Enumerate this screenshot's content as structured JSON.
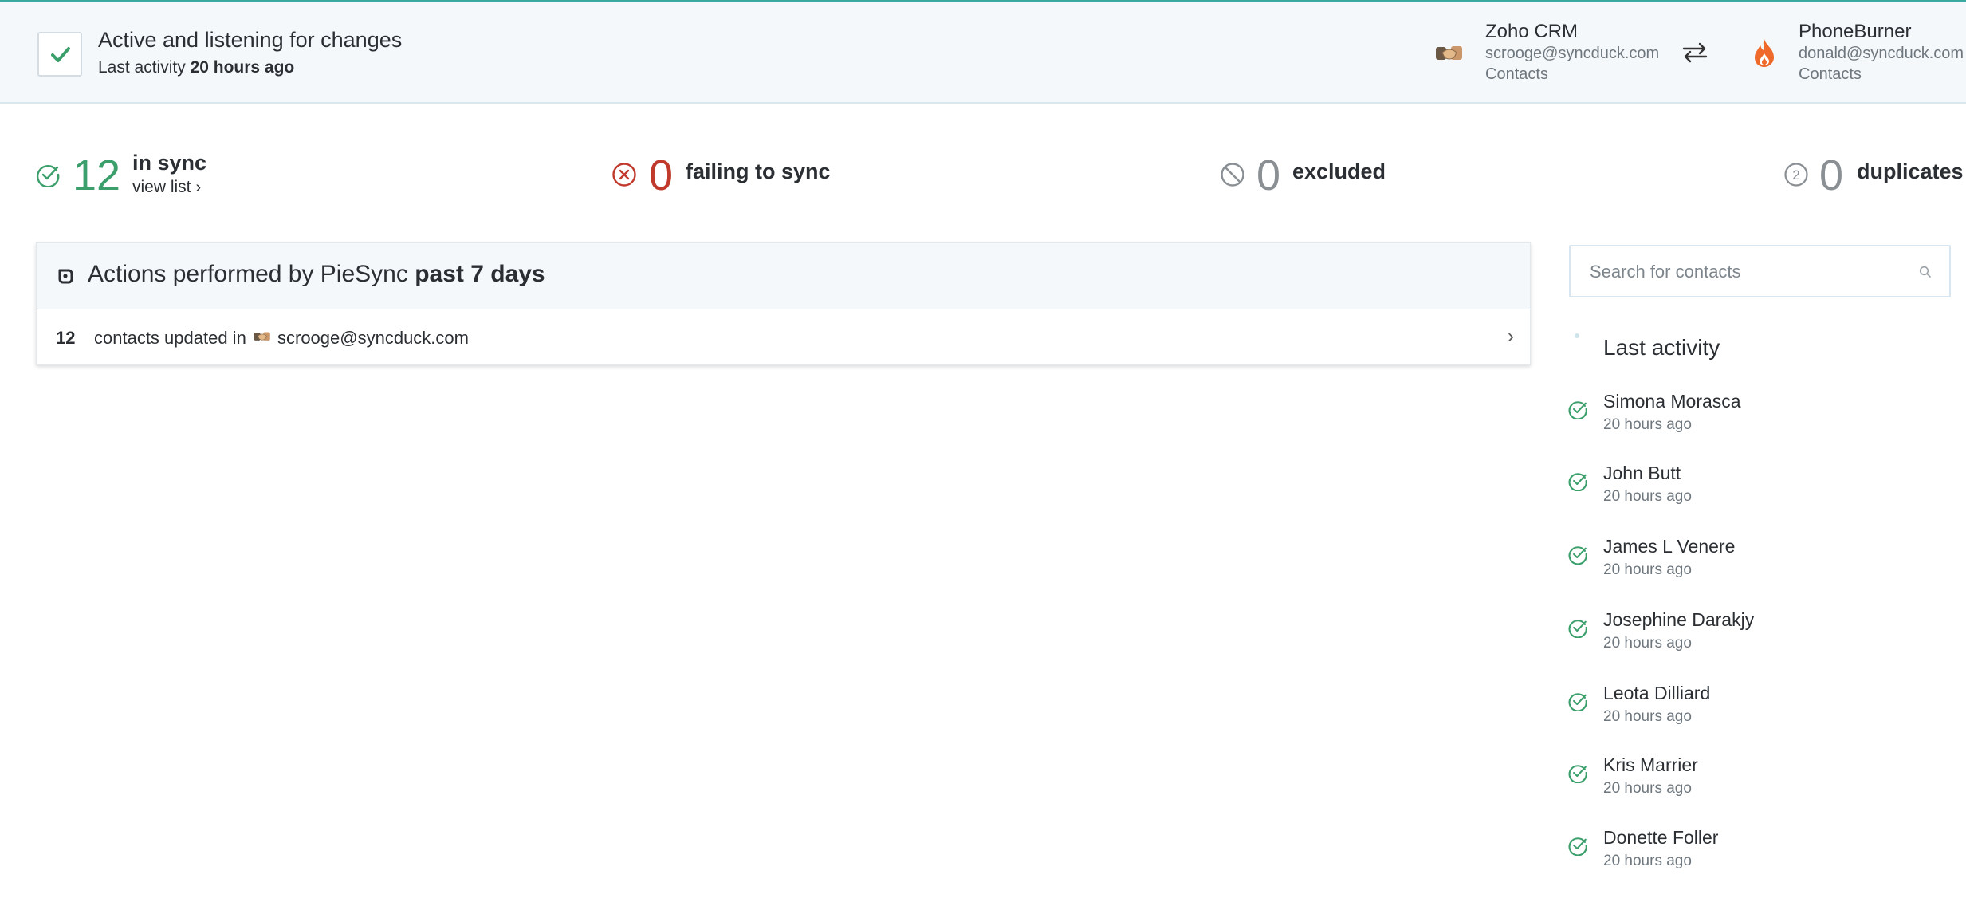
{
  "header": {
    "status_title": "Active and listening for changes",
    "last_activity_prefix": "Last activity",
    "last_activity_value": "20 hours ago",
    "app_left": {
      "name": "Zoho CRM",
      "email": "scrooge@syncduck.com",
      "object": "Contacts",
      "icon": "handshake-icon"
    },
    "app_right": {
      "name": "PhoneBurner",
      "email": "donald@syncduck.com",
      "object": "Contacts",
      "icon": "flame-icon"
    },
    "sync_direction_icon": "two-way-arrows-icon"
  },
  "stats": {
    "in_sync": {
      "count": "12",
      "label": "in sync",
      "link": "view list",
      "color": "#3a9f6b"
    },
    "failing": {
      "count": "0",
      "label": "failing to sync",
      "color": "#c0392b"
    },
    "excluded": {
      "count": "0",
      "label": "excluded",
      "color": "#8a8f94"
    },
    "duplicates": {
      "count": "0",
      "label": "duplicates",
      "badge": "2",
      "color": "#8a8f94"
    }
  },
  "actions": {
    "title_prefix": "Actions performed by PieSync",
    "title_period": "past 7 days",
    "rows": [
      {
        "count": "12",
        "text": "contacts updated in",
        "email": "scrooge@syncduck.com"
      }
    ]
  },
  "sidebar": {
    "search_placeholder": "Search for contacts",
    "search_value": "",
    "last_activity_title": "Last activity",
    "items": [
      {
        "name": "Simona Morasca",
        "time": "20 hours ago"
      },
      {
        "name": "John Butt",
        "time": "20 hours ago"
      },
      {
        "name": "James L Venere",
        "time": "20 hours ago"
      },
      {
        "name": "Josephine Darakjy",
        "time": "20 hours ago"
      },
      {
        "name": "Leota Dilliard",
        "time": "20 hours ago"
      },
      {
        "name": "Kris Marrier",
        "time": "20 hours ago"
      },
      {
        "name": "Donette Foller",
        "time": "20 hours ago"
      }
    ]
  },
  "colors": {
    "accent": "#3aa9a0",
    "success": "#3a9f6b",
    "error": "#c0392b",
    "muted": "#8a8f94",
    "header_bg": "#f4f8fb"
  }
}
